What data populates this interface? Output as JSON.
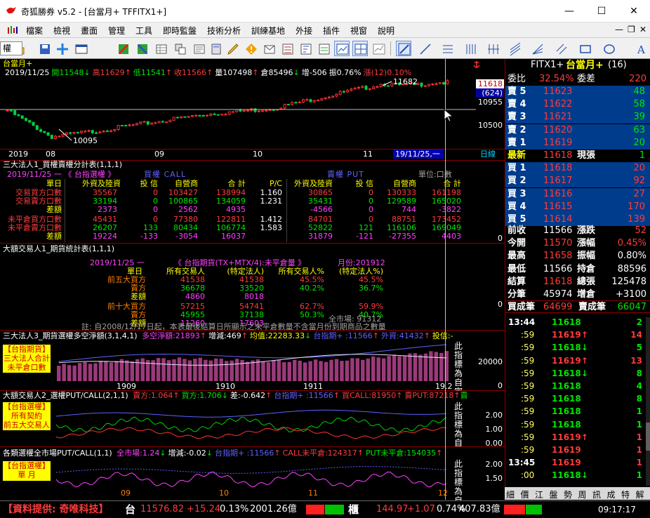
{
  "window": {
    "title": "奇狐勝券 v5.2 - [台當月+ TFFITX1+]",
    "min": "—",
    "max": "☐",
    "close": "✕"
  },
  "menu": [
    "檔案",
    "檢視",
    "畫面",
    "管理",
    "工具",
    "即時監盤",
    "技術分析",
    "訓練基地",
    "外接",
    "插件",
    "視窗",
    "說明"
  ],
  "mdi": {
    "min": "—",
    "restore": "❐",
    "close": "✕"
  },
  "toolbar": {
    "combo": "權"
  },
  "kline": {
    "name": "台當月+",
    "info": [
      {
        "t": "2019/11/25",
        "c": "w"
      },
      {
        "t": "開11548",
        "c": "g"
      },
      {
        "t": "↓",
        "c": "g"
      },
      {
        "t": "高11629",
        "c": "r"
      },
      {
        "t": "↑",
        "c": "r"
      },
      {
        "t": "低11541",
        "c": "g"
      },
      {
        "t": "↑",
        "c": "r"
      },
      {
        "t": "收11566",
        "c": "r"
      },
      {
        "t": "↑",
        "c": "r"
      },
      {
        "t": "量107498",
        "c": "w"
      },
      {
        "t": "↑",
        "c": "r"
      },
      {
        "t": "倉85496",
        "c": "w"
      },
      {
        "t": "↓",
        "c": "g"
      },
      {
        "t": "增-506",
        "c": "w"
      },
      {
        "t": "振0.76%",
        "c": "w"
      },
      {
        "t": "漲(12)0.10%",
        "c": "r"
      }
    ],
    "high_label": "11682",
    "low_label": "10095",
    "price_tag": "11618",
    "diff_tag": "(624)",
    "level_tag": "10955",
    "axis_label": "10500",
    "dates": [
      "2019",
      "08",
      "09",
      "10",
      "11"
    ],
    "cursor_date": "19/11/25,一",
    "period": "日線"
  },
  "p1": {
    "title": "三大法人1_買權賣權分計表(1,1,1)",
    "date": "2019/11/25 一 《 台指選權 》",
    "call": "買權 CALL",
    "put": "賣權 PUT",
    "unit": "單位:口數",
    "headers": [
      "單日",
      "外資及陸資",
      "投 信",
      "自營商",
      "合 計",
      "P/C",
      "外資及陸資",
      "投 信",
      "自營商",
      "合 計"
    ],
    "rows": [
      {
        "label": "交易買方口數",
        "v": [
          "35567",
          "0",
          "103427",
          "138994",
          "1.160",
          "30865",
          "0",
          "130333",
          "161198"
        ]
      },
      {
        "label": "交易賣方口數",
        "v": [
          "33194",
          "0",
          "100865",
          "134059",
          "1.231",
          "35431",
          "0",
          "129589",
          "165020"
        ]
      },
      {
        "label": "差額",
        "v": [
          "2373",
          "0",
          "2562",
          "4935",
          "",
          "-4566",
          "0",
          "744",
          "-3822"
        ]
      },
      {
        "label": "未平倉買方口數",
        "v": [
          "45431",
          "0",
          "77380",
          "122811",
          "1.412",
          "84701",
          "0",
          "88751",
          "173452"
        ]
      },
      {
        "label": "未平倉賣方口數",
        "v": [
          "26207",
          "133",
          "80434",
          "106774",
          "1.583",
          "52822",
          "121",
          "116106",
          "169049"
        ]
      },
      {
        "label": "差額",
        "v": [
          "19224",
          "-133",
          "-3054",
          "16037",
          "",
          "31879",
          "-121",
          "-27355",
          "4403"
        ]
      }
    ],
    "axis0": "0"
  },
  "p2": {
    "title": "大額交易人1_期貨統計表(1,1,1)",
    "date": "2019/11/25 一",
    "contract": "《 台指期貨(TX+MTX/4):未平倉量 》",
    "month": "月份:201912",
    "headers": [
      "單日",
      "所有交易人",
      "(特定法人)",
      "所有交易人%",
      "(特定法人%)"
    ],
    "rows": [
      {
        "label": "前五大買方",
        "v": [
          "41538",
          "41538",
          "45.5%",
          "45.5%"
        ]
      },
      {
        "label": "賣方",
        "v": [
          "36678",
          "33520",
          "40.2%",
          "36.7%"
        ]
      },
      {
        "label": "差額",
        "v": [
          "4860",
          "8018",
          "",
          ""
        ]
      },
      {
        "label": "前十大買方",
        "v": [
          "57215",
          "54741",
          "62.7%",
          "59.9%"
        ]
      },
      {
        "label": "賣方",
        "v": [
          "45955",
          "37138",
          "50.3%",
          "40.7%"
        ]
      },
      {
        "label": "差額",
        "v": [
          "11260",
          "17603",
          "",
          ""
        ]
      }
    ],
    "market": "全市場: 91312",
    "note": "註: 自2008/12/17日起，本表最後結算日所顯示之未平倉數量不含當月份到期商品之數量",
    "axis0": "0"
  },
  "p3": {
    "title": "三大法人3_期貨選權多空淨額(3,1,4,1)",
    "items": [
      {
        "t": "多空淨額:21893",
        "c": "m"
      },
      {
        "t": "↑",
        "c": "r"
      },
      {
        "t": "增減:469",
        "c": "w"
      },
      {
        "t": "↑",
        "c": "r"
      },
      {
        "t": "均值:22283.33",
        "c": "y"
      },
      {
        "t": "↓",
        "c": "g"
      },
      {
        "t": "台指期+ :11566",
        "c": "b"
      },
      {
        "t": "↑",
        "c": "r"
      },
      {
        "t": "外資:41432",
        "c": "b"
      },
      {
        "t": "↑",
        "c": "r"
      },
      {
        "t": "投信:-",
        "c": "y"
      }
    ],
    "label": [
      "【台指期貨】",
      "三大法人合計",
      "未平倉口數"
    ],
    "side": "此指標為自家資訊之",
    "axis": [
      "20000",
      "0"
    ],
    "xlabels": [
      "1909",
      "1910",
      "1911",
      "19.2"
    ]
  },
  "p4": {
    "title": "大額交易人2_選權PUT/CALL(2,1,1)",
    "items": [
      {
        "t": "賣方:1.064",
        "c": "r"
      },
      {
        "t": "↑",
        "c": "r"
      },
      {
        "t": "買方:1.706",
        "c": "g"
      },
      {
        "t": "↓",
        "c": "g"
      },
      {
        "t": "差:-0.642",
        "c": "w"
      },
      {
        "t": "↑",
        "c": "r"
      },
      {
        "t": "台指期+ :11566",
        "c": "b"
      },
      {
        "t": "↑",
        "c": "r"
      },
      {
        "t": "買CALL:81950",
        "c": "r"
      },
      {
        "t": "↑",
        "c": "r"
      },
      {
        "t": "賣PUT:87218",
        "c": "r"
      },
      {
        "t": "↑",
        "c": "r"
      },
      {
        "t": "賣",
        "c": "g"
      }
    ],
    "label": [
      "【台指選權】",
      "所有契約",
      "前五大交易人"
    ],
    "side": "此指標為自家資訊之",
    "axis": [
      "2.00",
      "1.00",
      "0.00"
    ]
  },
  "p5": {
    "title": "各類選權全市場PUT/CALL(1,1)",
    "items": [
      {
        "t": "全市場:1.24",
        "c": "m"
      },
      {
        "t": "↓",
        "c": "g"
      },
      {
        "t": "增減:-0.02",
        "c": "w"
      },
      {
        "t": "↓",
        "c": "g"
      },
      {
        "t": "台指期+ :11566",
        "c": "b"
      },
      {
        "t": "↑",
        "c": "r"
      },
      {
        "t": "CALL未平倉:124317",
        "c": "r"
      },
      {
        "t": "↑",
        "c": "r"
      },
      {
        "t": "PUT未平倉:154035",
        "c": "g"
      },
      {
        "t": "↑",
        "c": "r"
      }
    ],
    "label": [
      "【台指選權】",
      "單 月"
    ],
    "side": "此指標為自家資訊之",
    "axis": [
      "2.00",
      "1.50"
    ],
    "markers": [
      "09",
      "10",
      "11",
      "12"
    ]
  },
  "quote": {
    "header": {
      "code": "FITX1+",
      "name": "台當月+",
      "count": "(16)"
    },
    "ratio": {
      "l": "委比",
      "v": "32.54%",
      "l2": "委差",
      "v2": "220"
    },
    "asks": [
      {
        "l": "賣 5",
        "p": "11623",
        "q": "48"
      },
      {
        "l": "賣 4",
        "p": "11622",
        "q": "58"
      },
      {
        "l": "賣 3",
        "p": "11621",
        "q": "39"
      },
      {
        "l": "賣 2",
        "p": "11620",
        "q": "63"
      },
      {
        "l": "賣 1",
        "p": "11619",
        "q": "20"
      }
    ],
    "last": {
      "l": "最新",
      "p": "11618",
      "l2": "現張",
      "q": "1"
    },
    "bids": [
      {
        "l": "買 1",
        "p": "11618",
        "q": "20"
      },
      {
        "l": "買 2",
        "p": "11617",
        "q": "92"
      },
      {
        "l": "買 3",
        "p": "11616",
        "q": "27"
      },
      {
        "l": "買 4",
        "p": "11615",
        "q": "170"
      },
      {
        "l": "買 5",
        "p": "11614",
        "q": "139"
      }
    ],
    "stats": [
      {
        "l": "前收",
        "v": "11566",
        "l2": "漲跌",
        "v2": "52"
      },
      {
        "l": "今開",
        "v": "11570",
        "l2": "漲幅",
        "v2": "0.45%"
      },
      {
        "l": "最高",
        "v": "11658",
        "l2": "振幅",
        "v2": "0.80%"
      },
      {
        "l": "最低",
        "v": "11566",
        "l2": "持倉",
        "v2": "88596"
      },
      {
        "l": "結算",
        "v": "11618",
        "l2": "總張",
        "v2": "125478"
      },
      {
        "l": "分筆",
        "v": "45974",
        "l2": "增倉",
        "v2": "+3100"
      }
    ],
    "vol": {
      "l": "買成筆",
      "v": "64699",
      "l2": "賣成筆",
      "v2": "66047"
    },
    "ticks": [
      {
        "t": "13:44",
        "p": "11618",
        "a": "",
        "q": "2",
        "c": "g"
      },
      {
        "t": ":59",
        "p": "11619",
        "a": "↑",
        "q": "14",
        "c": "r"
      },
      {
        "t": ":59",
        "p": "11618",
        "a": "↓",
        "q": "5",
        "c": "g"
      },
      {
        "t": ":59",
        "p": "11619",
        "a": "↑",
        "q": "13",
        "c": "r"
      },
      {
        "t": ":59",
        "p": "11618",
        "a": "↓",
        "q": "8",
        "c": "g"
      },
      {
        "t": ":59",
        "p": "11618",
        "a": "",
        "q": "4",
        "c": "g"
      },
      {
        "t": ":59",
        "p": "11618",
        "a": "",
        "q": "8",
        "c": "g"
      },
      {
        "t": ":59",
        "p": "11618",
        "a": "",
        "q": "1",
        "c": "g"
      },
      {
        "t": ":59",
        "p": "11618",
        "a": "",
        "q": "1",
        "c": "g"
      },
      {
        "t": ":59",
        "p": "11619",
        "a": "↑",
        "q": "1",
        "c": "r"
      },
      {
        "t": ":59",
        "p": "11619",
        "a": "",
        "q": "1",
        "c": "r"
      },
      {
        "t": "13:45",
        "p": "11619",
        "a": "",
        "q": "1",
        "c": "r"
      },
      {
        "t": ":00",
        "p": "11618",
        "a": "↓",
        "q": "1",
        "c": "g"
      }
    ],
    "tabs": [
      "細",
      "價",
      "江",
      "盤",
      "勢",
      "周",
      "訊",
      "成",
      "特",
      "解"
    ]
  },
  "status": {
    "provider": "【資料提供: 奇唯科技】",
    "tw_name": "台",
    "tw": "11576.82",
    "tw_chg": "+15.24",
    "tw_pct": "0.13%",
    "tw_vol": "2001.26億",
    "otc_name": "櫃",
    "otc": "144.97",
    "otc_chg": "+1.07",
    "otc_pct": "0.74%",
    "otc_vol": "407.83億",
    "time": "09:17:17"
  }
}
